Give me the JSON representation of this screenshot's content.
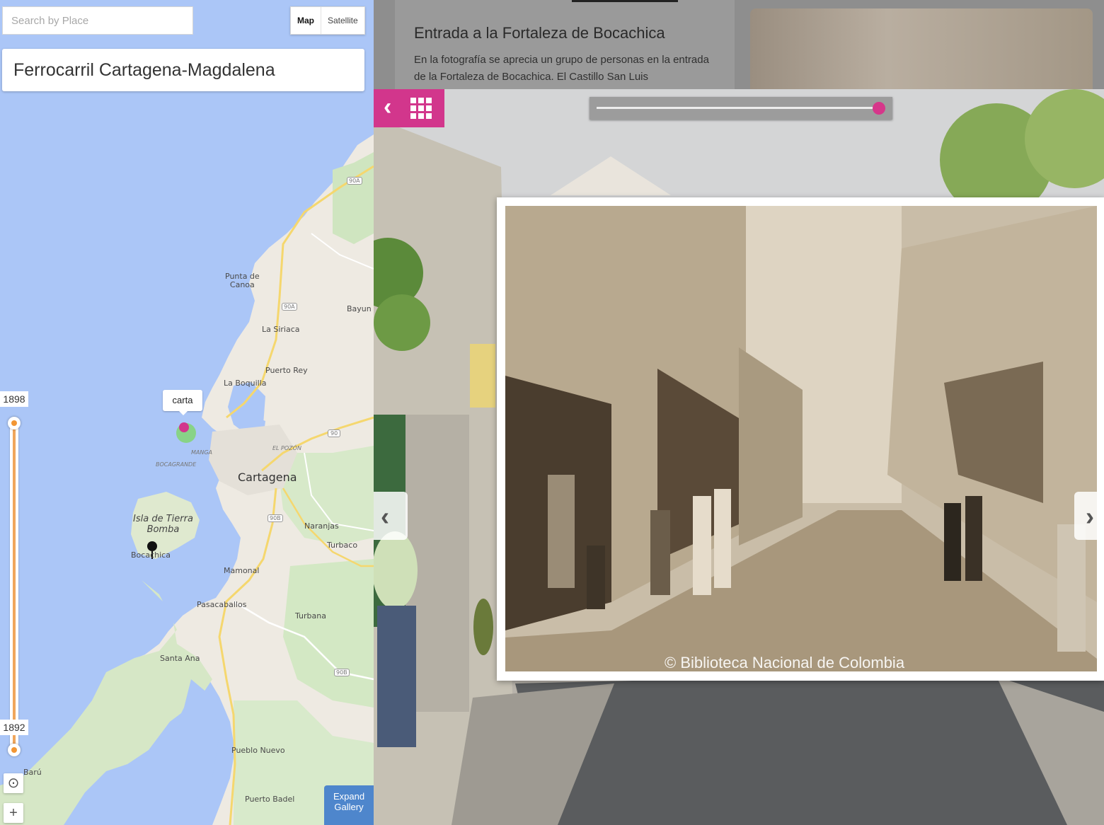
{
  "search": {
    "placeholder": "Search by Place"
  },
  "map_type": {
    "map": "Map",
    "satellite": "Satellite"
  },
  "title": "Ferrocarril Cartagena-Magdalena",
  "map_labels": {
    "punta_canoa": "Punta de\nCanoa",
    "bayunca": "Bayun",
    "la_siriaca": "La Siriaca",
    "puerto_rey": "Puerto Rey",
    "la_boquilla": "La Boquilla",
    "cartagena": "Cartagena",
    "el_pozon": "EL POZÓN",
    "manga": "MANGA",
    "bocagrande": "BOCAGRANDE",
    "isla_tierra_bomba": "Isla de Tierra\nBomba",
    "bocachica": "Bocachica",
    "naranjas": "Naranjas",
    "turbaco": "Turbaco",
    "mamonal": "Mamonal",
    "pasacaballos": "Pasacaballos",
    "turbana": "Turbana",
    "santa_ana": "Santa Ana",
    "pueblo_nuevo": "Pueblo Nuevo",
    "puerto_badel": "Puerto Badel",
    "baru": "Barú",
    "road_90a": "90A",
    "road_90a_2": "90A",
    "road_90": "90",
    "road_90b": "90B",
    "road_90b_2": "90B"
  },
  "pin": {
    "tooltip": "carta"
  },
  "timeline": {
    "start_year": "1898",
    "end_year": "1892"
  },
  "controls": {
    "locate": "⊙",
    "zoom_in": "+"
  },
  "expand_gallery": {
    "label": "Expand Gallery"
  },
  "card": {
    "title": "Entrada a la Fortaleza de Bocachica",
    "description": "En la fotografía se aprecia un grupo de personas en la entrada de la Fortaleza de Bocachica. El Castillo San Luis"
  },
  "overlay_opacity": 1.0,
  "photo": {
    "credit": "© Biblioteca Nacional de Colombia"
  },
  "icons": {
    "back": "chevron-left-icon",
    "grid": "grid-icon",
    "prev": "chevron-left-icon",
    "next": "chevron-right-icon"
  },
  "colors": {
    "accent": "#d2368c",
    "timeline": "#f29634",
    "expand": "#4e86cc"
  }
}
